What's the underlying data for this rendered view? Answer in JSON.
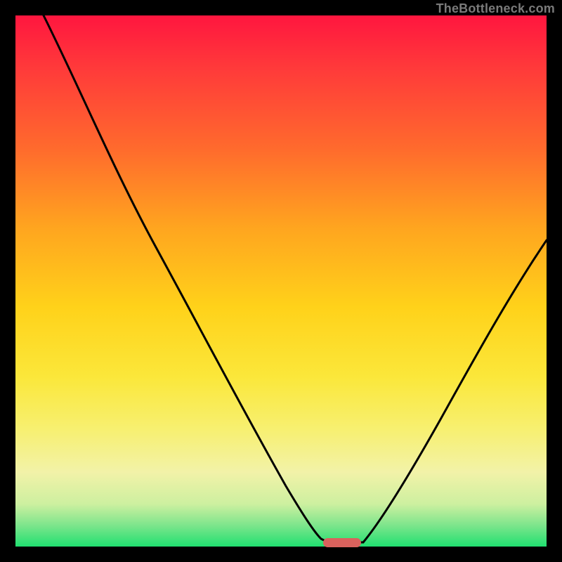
{
  "watermark": "TheBottleneck.com",
  "colors": {
    "frame_border": "#000000",
    "curve_stroke": "#000000",
    "marker_fill": "#d9625d",
    "gradient_top": "#ff163f",
    "gradient_bottom": "#20e070",
    "watermark_text": "#7a7a7a"
  },
  "chart_data": {
    "type": "line",
    "title": "",
    "xlabel": "",
    "ylabel": "",
    "xlim": [
      0,
      100
    ],
    "ylim": [
      0,
      100
    ],
    "grid": false,
    "legend": null,
    "series": [
      {
        "name": "left-branch",
        "x": [
          5,
          12,
          19,
          26,
          34,
          42,
          51,
          55,
          58,
          59
        ],
        "y": [
          100,
          87,
          71,
          56,
          42,
          27,
          12,
          6,
          2,
          1
        ]
      },
      {
        "name": "floor",
        "x": [
          58,
          65
        ],
        "y": [
          1,
          1
        ]
      },
      {
        "name": "right-branch",
        "x": [
          65,
          69,
          74,
          80,
          87,
          93,
          100
        ],
        "y": [
          1,
          5,
          13,
          24,
          36,
          48,
          58
        ]
      }
    ],
    "annotations": [
      {
        "name": "optimal-marker",
        "shape": "pill",
        "x_center": 61,
        "y": 1,
        "width_x_units": 7
      }
    ],
    "notes": "x and y are percentages of the visible plot area (0 = left / bottom edge inside the black frame, 100 = right / top edge). Values are read off the screenshot; no numeric axes are shown in the source image so values are spatial estimates at ~1 significant figure of precision."
  }
}
